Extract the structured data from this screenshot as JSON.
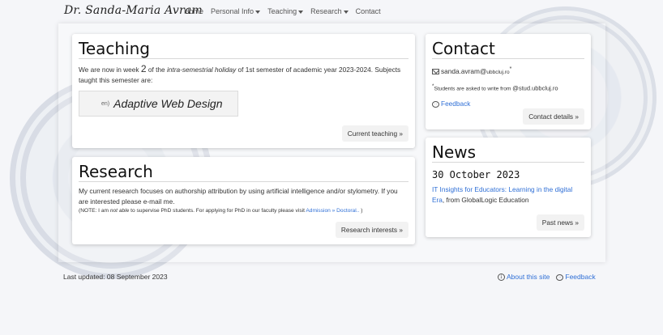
{
  "navbar": {
    "brand": "Dr. Sanda-Maria Avram",
    "items": [
      "Home",
      "Personal Info",
      "Teaching",
      "Research",
      "Contact"
    ]
  },
  "teaching": {
    "title": "Teaching",
    "intro_1": "We are now in week ",
    "week": "2",
    "intro_2": " of the ",
    "holiday": "intra-semestrial holiday",
    "intro_3": " of 1st semester of academic year 2023-2024. Subjects taught this semester are:",
    "subject_lang": "en)",
    "subject_name": "Adaptive Web Design",
    "button": "Current teaching »"
  },
  "research": {
    "title": "Research",
    "text": "My current research focuses on authorship attribution by using artificial intelligence and/or stylometry. If you are interested please e-mail me.",
    "note_1": "(NOTE: I am ",
    "note_emph": "not able",
    "note_2": " to supervise PhD students. For applying for PhD in our faculty please visit ",
    "note_link": "Admission » Doctoral..",
    "note_3": " )",
    "button": "Research interests »"
  },
  "contact": {
    "title": "Contact",
    "email_user": "sanda.avram",
    "email_at": "@",
    "email_domain": "ubbcluj.ro",
    "email_mark": "*",
    "note_mark": "*",
    "note_text": "Students are asked to write from ",
    "note_domain": "@stud.ubbcluj.ro",
    "feedback": "Feedback",
    "button": "Contact details »"
  },
  "news": {
    "title": "News",
    "date": "30 October 2023",
    "link": "IT Insights for Educators: Learning in the digital Era",
    "suffix": ", from GlobalLogic Education",
    "button": "Past news »"
  },
  "footer": {
    "updated": "Last updated: 08 September 2023",
    "about": "About this site",
    "feedback": "Feedback"
  },
  "colors": {
    "link": "#2f6fd6",
    "background": "#f5f6f9"
  }
}
